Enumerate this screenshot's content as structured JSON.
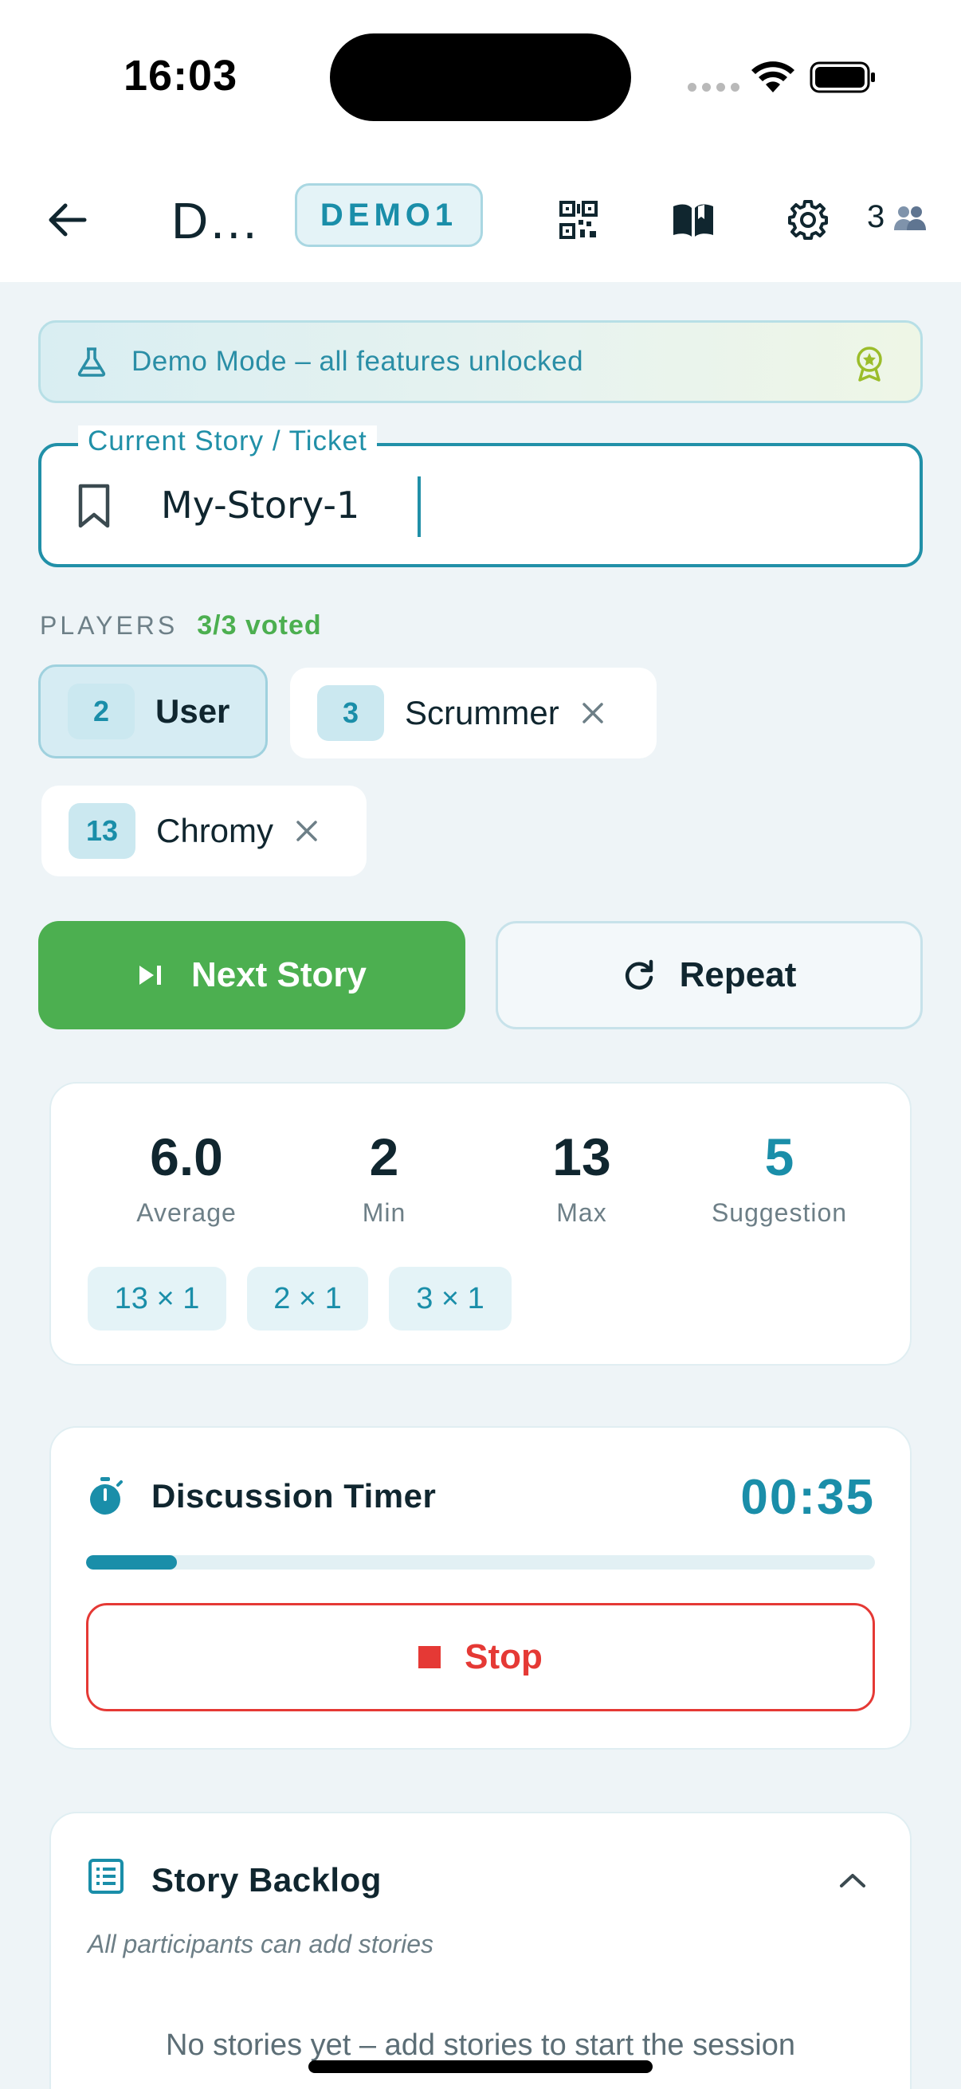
{
  "status_bar": {
    "time": "16:03"
  },
  "header": {
    "back_icon": "arrow-left-icon",
    "title": "D…",
    "room_code": "DEMO1",
    "qr_icon": "qr-code-icon",
    "rules_icon": "book-open-icon",
    "settings_icon": "gear-icon",
    "participants_count": "3",
    "participants_icon": "people-icon"
  },
  "demo_banner": {
    "text": "Demo Mode – all features unlocked",
    "icon": "flask-icon",
    "badge_icon": "award-icon"
  },
  "story": {
    "label": "Current Story / Ticket",
    "value": "My-Story-1",
    "icon": "bookmark-icon"
  },
  "players": {
    "label": "PLAYERS",
    "voted": "3/3 voted",
    "list": [
      {
        "vote": "2",
        "name": "User",
        "is_self": true
      },
      {
        "vote": "3",
        "name": "Scrummer",
        "removable": true
      },
      {
        "vote": "13",
        "name": "Chromy",
        "removable": true
      }
    ]
  },
  "actions": {
    "next_story": "Next Story",
    "repeat": "Repeat"
  },
  "stats": {
    "average": {
      "value": "6.0",
      "label": "Average"
    },
    "min": {
      "value": "2",
      "label": "Min"
    },
    "max": {
      "value": "13",
      "label": "Max"
    },
    "suggestion": {
      "value": "5",
      "label": "Suggestion"
    },
    "distribution": [
      "13 × 1",
      "2 × 1",
      "3 × 1"
    ]
  },
  "timer": {
    "title": "Discussion Timer",
    "value": "00:35",
    "progress": 0.115,
    "stop_label": "Stop"
  },
  "backlog": {
    "title": "Story Backlog",
    "hint": "All participants can add stories",
    "empty": "No stories yet – add stories to start the session"
  },
  "colors": {
    "accent": "#1a8ea9",
    "success": "#4caf50",
    "danger": "#e53935"
  }
}
